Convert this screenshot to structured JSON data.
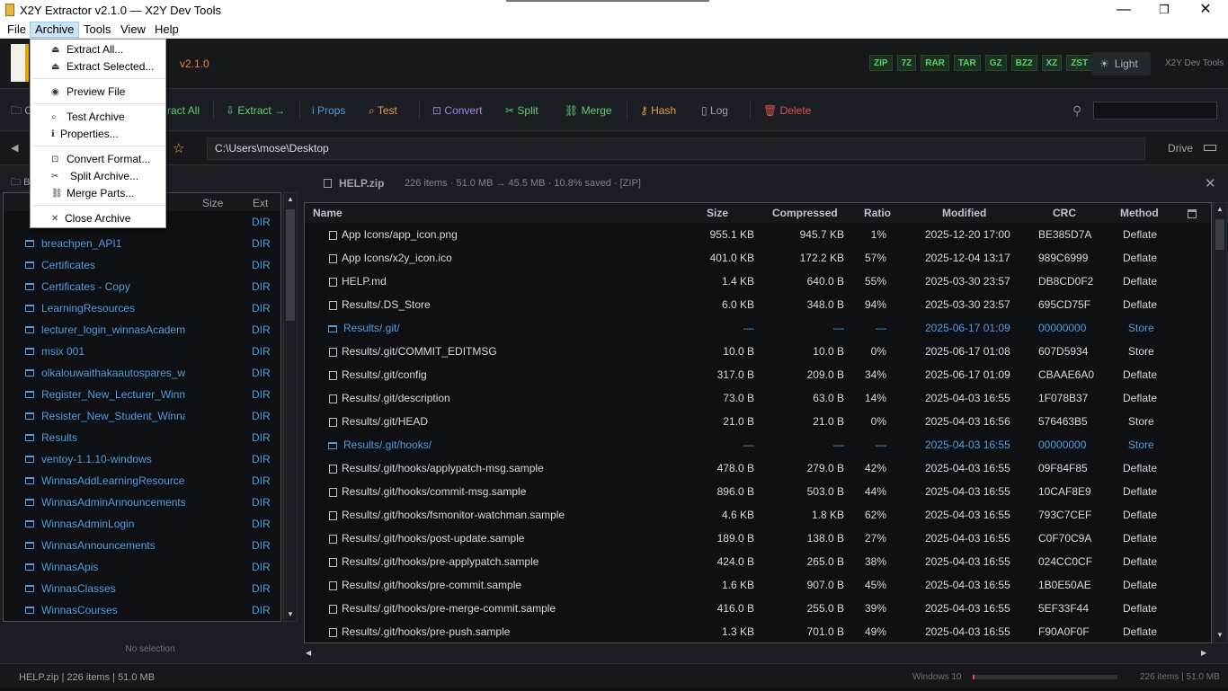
{
  "window": {
    "title": "X2Y Extractor v2.1.0  —  X2Y Dev Tools",
    "controls": {
      "minimize": "—",
      "maximize": "❐",
      "close": "✕"
    }
  },
  "menubar": [
    "File",
    "Archive",
    "Tools",
    "View",
    "Help"
  ],
  "archive_menu": {
    "items": [
      "Extract All...",
      "Extract Selected...",
      "Preview File",
      "Test Archive",
      "Properties...",
      "Convert Format...",
      "Split Archive...",
      "Merge Parts...",
      "Close Archive"
    ]
  },
  "header": {
    "version": "v2.1.0",
    "formats": [
      "ZIP",
      "7Z",
      "RAR",
      "TAR",
      "GZ",
      "BZ2",
      "XZ",
      "ZST"
    ],
    "theme_button": "Light",
    "brand": "X2Y Dev Tools"
  },
  "toolbar": {
    "open_partial": "O",
    "extract_all_partial": "ract All",
    "extract": "Extract →",
    "props": "Props",
    "test": "Test",
    "convert": "Convert",
    "split": "Split",
    "merge": "Merge",
    "hash": "Hash",
    "log": "Log",
    "delete": "Delete",
    "search_value": "",
    "colors": {
      "green": "#5dcf6d",
      "blue": "#4c9ee0",
      "orange": "#e0a040",
      "purple": "#b07ee8",
      "red": "#e05050",
      "grey": "#9aa3ae"
    }
  },
  "address": {
    "path": "C:\\Users\\mose\\Desktop",
    "drive": "Drive"
  },
  "left_panel": {
    "title_partial": "B",
    "columns": {
      "size": "Size",
      "ext": "Ext"
    },
    "items": [
      {
        "name": "breachpen_API1",
        "ext": "DIR"
      },
      {
        "name": "Certificates",
        "ext": "DIR"
      },
      {
        "name": "Certificates - Copy",
        "ext": "DIR"
      },
      {
        "name": "LearningResources",
        "ext": "DIR"
      },
      {
        "name": "lecturer_login_winnasAcademy",
        "ext": "DIR"
      },
      {
        "name": "msix 001",
        "ext": "DIR"
      },
      {
        "name": "olkalouwaithakaautospares_wi",
        "ext": "DIR"
      },
      {
        "name": "Register_New_Lecturer_Winnas",
        "ext": "DIR"
      },
      {
        "name": "Resister_New_Student_Winnas",
        "ext": "DIR"
      },
      {
        "name": "Results",
        "ext": "DIR"
      },
      {
        "name": "ventoy-1.1.10-windows",
        "ext": "DIR"
      },
      {
        "name": "WinnasAddLearningResources",
        "ext": "DIR"
      },
      {
        "name": "WinnasAdminAnnouncements",
        "ext": "DIR"
      },
      {
        "name": "WinnasAdminLogin",
        "ext": "DIR"
      },
      {
        "name": "WinnasAnnouncements",
        "ext": "DIR"
      },
      {
        "name": "WinnasApis",
        "ext": "DIR"
      },
      {
        "name": "WinnasClasses",
        "ext": "DIR"
      },
      {
        "name": "WinnasCourses",
        "ext": "DIR"
      }
    ],
    "top_partial_ext": "DIR",
    "no_selection": "No selection"
  },
  "archive_view": {
    "name": "HELP.zip",
    "info": "226 items  ·  51.0 MB → 45.5 MB  ·  10.8% saved  ·  [ZIP]",
    "columns": [
      "Name",
      "Size",
      "Compressed",
      "Ratio",
      "Modified",
      "CRC",
      "Method"
    ],
    "rows": [
      {
        "name": "App Icons/app_icon.png",
        "size": "955.1 KB",
        "comp": "945.7 KB",
        "ratio": "1%",
        "mod": "2025-12-20 17:00",
        "crc": "BE385D7A",
        "method": "Deflate",
        "dir": false
      },
      {
        "name": "App Icons/x2y_icon.ico",
        "size": "401.0 KB",
        "comp": "172.2 KB",
        "ratio": "57%",
        "mod": "2025-12-04 13:17",
        "crc": "989C6999",
        "method": "Deflate",
        "dir": false
      },
      {
        "name": "HELP.md",
        "size": "1.4 KB",
        "comp": "640.0 B",
        "ratio": "55%",
        "mod": "2025-03-30 23:57",
        "crc": "DB8CD0F2",
        "method": "Deflate",
        "dir": false
      },
      {
        "name": "Results/.DS_Store",
        "size": "6.0 KB",
        "comp": "348.0 B",
        "ratio": "94%",
        "mod": "2025-03-30 23:57",
        "crc": "695CD75F",
        "method": "Deflate",
        "dir": false
      },
      {
        "name": "Results/.git/",
        "size": "—",
        "comp": "—",
        "ratio": "—",
        "mod": "2025-06-17 01:09",
        "crc": "00000000",
        "method": "Store",
        "dir": true
      },
      {
        "name": "Results/.git/COMMIT_EDITMSG",
        "size": "10.0 B",
        "comp": "10.0 B",
        "ratio": "0%",
        "mod": "2025-06-17 01:08",
        "crc": "607D5934",
        "method": "Store",
        "dir": false
      },
      {
        "name": "Results/.git/config",
        "size": "317.0 B",
        "comp": "209.0 B",
        "ratio": "34%",
        "mod": "2025-06-17 01:09",
        "crc": "CBAAE6A0",
        "method": "Deflate",
        "dir": false
      },
      {
        "name": "Results/.git/description",
        "size": "73.0 B",
        "comp": "63.0 B",
        "ratio": "14%",
        "mod": "2025-04-03 16:55",
        "crc": "1F078B37",
        "method": "Deflate",
        "dir": false
      },
      {
        "name": "Results/.git/HEAD",
        "size": "21.0 B",
        "comp": "21.0 B",
        "ratio": "0%",
        "mod": "2025-04-03 16:56",
        "crc": "576463B5",
        "method": "Store",
        "dir": false
      },
      {
        "name": "Results/.git/hooks/",
        "size": "—",
        "comp": "—",
        "ratio": "—",
        "mod": "2025-04-03 16:55",
        "crc": "00000000",
        "method": "Store",
        "dir": true
      },
      {
        "name": "Results/.git/hooks/applypatch-msg.sample",
        "size": "478.0 B",
        "comp": "279.0 B",
        "ratio": "42%",
        "mod": "2025-04-03 16:55",
        "crc": "09F84F85",
        "method": "Deflate",
        "dir": false
      },
      {
        "name": "Results/.git/hooks/commit-msg.sample",
        "size": "896.0 B",
        "comp": "503.0 B",
        "ratio": "44%",
        "mod": "2025-04-03 16:55",
        "crc": "10CAF8E9",
        "method": "Deflate",
        "dir": false
      },
      {
        "name": "Results/.git/hooks/fsmonitor-watchman.sample",
        "size": "4.6 KB",
        "comp": "1.8 KB",
        "ratio": "62%",
        "mod": "2025-04-03 16:55",
        "crc": "793C7CEF",
        "method": "Deflate",
        "dir": false
      },
      {
        "name": "Results/.git/hooks/post-update.sample",
        "size": "189.0 B",
        "comp": "138.0 B",
        "ratio": "27%",
        "mod": "2025-04-03 16:55",
        "crc": "C0F70C9A",
        "method": "Deflate",
        "dir": false
      },
      {
        "name": "Results/.git/hooks/pre-applypatch.sample",
        "size": "424.0 B",
        "comp": "265.0 B",
        "ratio": "38%",
        "mod": "2025-04-03 16:55",
        "crc": "024CC0CF",
        "method": "Deflate",
        "dir": false
      },
      {
        "name": "Results/.git/hooks/pre-commit.sample",
        "size": "1.6 KB",
        "comp": "907.0 B",
        "ratio": "45%",
        "mod": "2025-04-03 16:55",
        "crc": "1B0E50AE",
        "method": "Deflate",
        "dir": false
      },
      {
        "name": "Results/.git/hooks/pre-merge-commit.sample",
        "size": "416.0 B",
        "comp": "255.0 B",
        "ratio": "39%",
        "mod": "2025-04-03 16:55",
        "crc": "5EF33F44",
        "method": "Deflate",
        "dir": false
      },
      {
        "name": "Results/.git/hooks/pre-push.sample",
        "size": "1.3 KB",
        "comp": "701.0 B",
        "ratio": "49%",
        "mod": "2025-04-03 16:55",
        "crc": "F90A0F0F",
        "method": "Deflate",
        "dir": false
      }
    ]
  },
  "status": {
    "left": "HELP.zip  |  226 items  |  51.0 MB",
    "os": "Windows 10",
    "progress": 0.01,
    "right": "226 items | 51.0 MB"
  },
  "icons": {
    "search": "search-icon",
    "star": "star-icon",
    "close": "close-icon",
    "folder": "folder-icon",
    "file": "file-icon"
  }
}
